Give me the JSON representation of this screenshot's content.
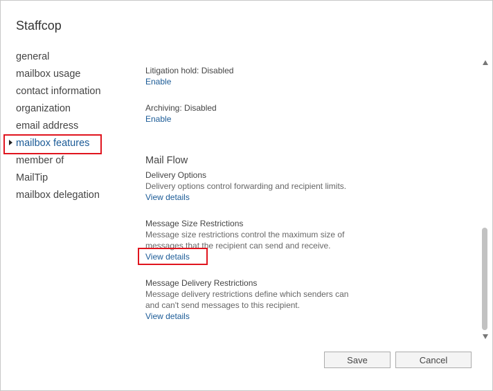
{
  "dialog": {
    "title": "Staffcop"
  },
  "nav": {
    "items": [
      {
        "label": "general"
      },
      {
        "label": "mailbox usage"
      },
      {
        "label": "contact information"
      },
      {
        "label": "organization"
      },
      {
        "label": "email address"
      },
      {
        "label": "mailbox features",
        "selected": true
      },
      {
        "label": "member of"
      },
      {
        "label": "MailTip"
      },
      {
        "label": "mailbox delegation"
      }
    ]
  },
  "content": {
    "litigation_hold": {
      "status": "Litigation hold: Disabled",
      "link": "Enable"
    },
    "archiving": {
      "status": "Archiving: Disabled",
      "link": "Enable"
    },
    "mail_flow": {
      "heading": "Mail Flow",
      "delivery_options": {
        "title": "Delivery Options",
        "description": "Delivery options control forwarding and recipient limits.",
        "link": "View details"
      },
      "message_size_restrictions": {
        "title": "Message Size Restrictions",
        "description": "Message size restrictions control the maximum size of messages that the recipient can send and receive.",
        "link": "View details"
      },
      "message_delivery_restrictions": {
        "title": "Message Delivery Restrictions",
        "description": "Message delivery restrictions define which senders can and can't send messages to this recipient.",
        "link": "View details"
      }
    }
  },
  "footer": {
    "save_label": "Save",
    "cancel_label": "Cancel"
  },
  "colors": {
    "link": "#1a5a96",
    "highlight": "#e0141e"
  }
}
